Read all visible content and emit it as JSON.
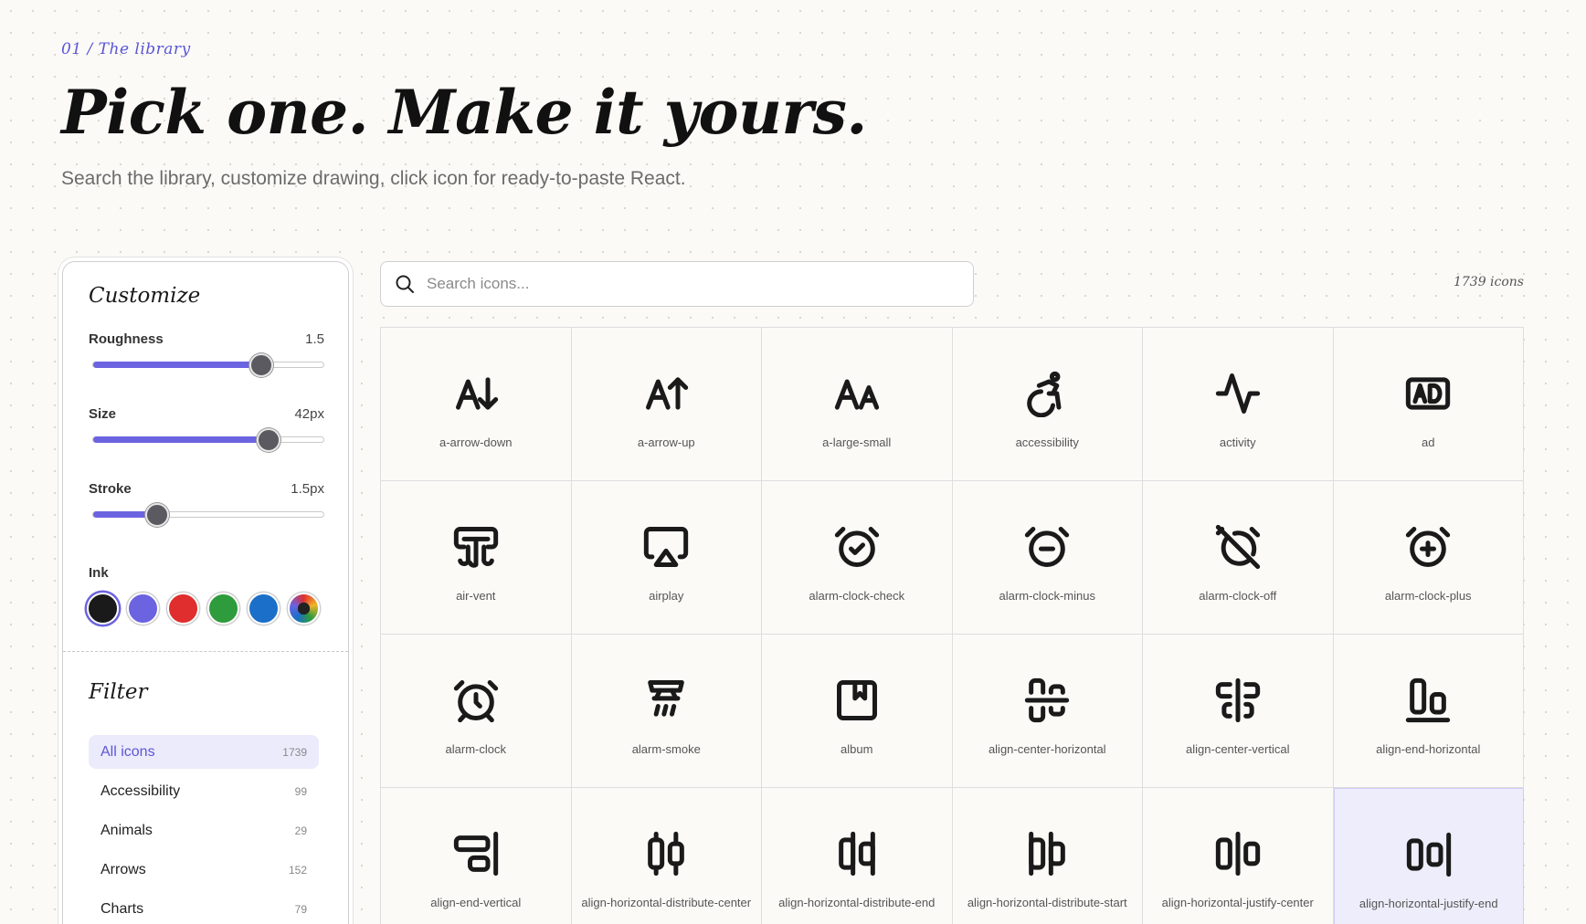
{
  "header": {
    "breadcrumb": "01 / The library",
    "title": "Pick one. Make it yours.",
    "subtitle": "Search the library, customize drawing, click icon for ready-to-paste React."
  },
  "customize": {
    "title": "Customize",
    "sliders": [
      {
        "label": "Roughness",
        "value": "1.5",
        "fraction": 0.73
      },
      {
        "label": "Size",
        "value": "42px",
        "fraction": 0.76
      },
      {
        "label": "Stroke",
        "value": "1.5px",
        "fraction": 0.28
      }
    ],
    "ink_label": "Ink",
    "ink_colors": [
      "#1a1a1a",
      "#6b63e0",
      "#e02d2d",
      "#2e9b3c",
      "#1b6fc9",
      "rainbow"
    ],
    "selected_ink": 0
  },
  "filter": {
    "title": "Filter",
    "items": [
      {
        "label": "All icons",
        "count": "1739",
        "active": true
      },
      {
        "label": "Accessibility",
        "count": "99"
      },
      {
        "label": "Animals",
        "count": "29"
      },
      {
        "label": "Arrows",
        "count": "152"
      },
      {
        "label": "Charts",
        "count": "79"
      }
    ]
  },
  "search": {
    "placeholder": "Search icons..."
  },
  "icon_count": "1739 icons",
  "icons": [
    {
      "name": "a-arrow-down",
      "icon": "a-arrow-down-icon"
    },
    {
      "name": "a-arrow-up",
      "icon": "a-arrow-up-icon"
    },
    {
      "name": "a-large-small",
      "icon": "a-large-small-icon"
    },
    {
      "name": "accessibility",
      "icon": "accessibility-icon"
    },
    {
      "name": "activity",
      "icon": "activity-icon"
    },
    {
      "name": "ad",
      "icon": "ad-icon"
    },
    {
      "name": "air-vent",
      "icon": "air-vent-icon"
    },
    {
      "name": "airplay",
      "icon": "airplay-icon"
    },
    {
      "name": "alarm-clock-check",
      "icon": "alarm-clock-check-icon"
    },
    {
      "name": "alarm-clock-minus",
      "icon": "alarm-clock-minus-icon"
    },
    {
      "name": "alarm-clock-off",
      "icon": "alarm-clock-off-icon"
    },
    {
      "name": "alarm-clock-plus",
      "icon": "alarm-clock-plus-icon"
    },
    {
      "name": "alarm-clock",
      "icon": "alarm-clock-icon"
    },
    {
      "name": "alarm-smoke",
      "icon": "alarm-smoke-icon"
    },
    {
      "name": "album",
      "icon": "album-icon"
    },
    {
      "name": "align-center-horizontal",
      "icon": "align-center-horizontal-icon"
    },
    {
      "name": "align-center-vertical",
      "icon": "align-center-vertical-icon"
    },
    {
      "name": "align-end-horizontal",
      "icon": "align-end-horizontal-icon"
    },
    {
      "name": "align-end-vertical",
      "icon": "align-end-vertical-icon"
    },
    {
      "name": "align-horizontal-distribute-center",
      "icon": "align-horizontal-distribute-center-icon"
    },
    {
      "name": "align-horizontal-distribute-end",
      "icon": "align-horizontal-distribute-end-icon"
    },
    {
      "name": "align-horizontal-distribute-start",
      "icon": "align-horizontal-distribute-start-icon"
    },
    {
      "name": "align-horizontal-justify-center",
      "icon": "align-horizontal-justify-center-icon"
    },
    {
      "name": "align-horizontal-justify-end",
      "icon": "align-horizontal-justify-end-icon",
      "hovered": true
    }
  ]
}
